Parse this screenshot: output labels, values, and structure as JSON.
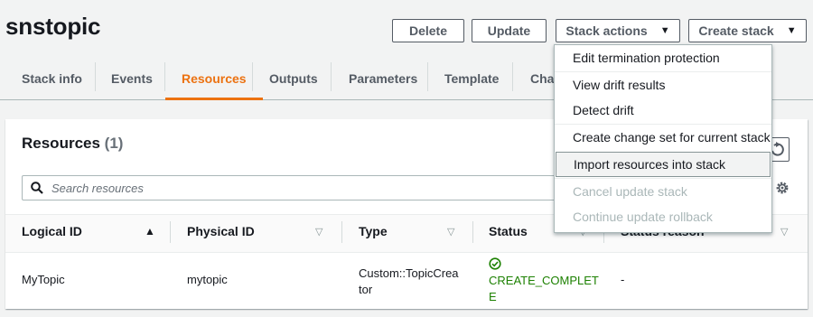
{
  "stack_name": "snstopic",
  "header_buttons": {
    "delete": "Delete",
    "update": "Update",
    "stack_actions": "Stack actions",
    "create_stack": "Create stack"
  },
  "tabs": [
    "Stack info",
    "Events",
    "Resources",
    "Outputs",
    "Parameters",
    "Template",
    "Char"
  ],
  "active_tab": "Resources",
  "resources": {
    "title": "Resources",
    "count": "(1)",
    "search_placeholder": "Search resources",
    "columns": [
      "Logical ID",
      "Physical ID",
      "Type",
      "Status",
      "Status reason"
    ],
    "rows": [
      {
        "logical_id": "MyTopic",
        "physical_id": "mytopic",
        "type_line1": "Custom::TopicCrea",
        "type_line2": "tor",
        "status_line1": "CREATE_COMPLET",
        "status_line2": "E",
        "status_reason": "-"
      }
    ]
  },
  "stack_actions_menu": [
    {
      "label": "Edit termination protection",
      "enabled": true
    },
    {
      "label": "View drift results",
      "enabled": true
    },
    {
      "label": "Detect drift",
      "enabled": true
    },
    {
      "label": "Create change set for current stack",
      "enabled": true
    },
    {
      "label": "Import resources into stack",
      "enabled": true,
      "highlighted": true
    },
    {
      "label": "Cancel update stack",
      "enabled": false
    },
    {
      "label": "Continue update rollback",
      "enabled": false
    }
  ],
  "colors": {
    "accent": "#ec7211",
    "success": "#1d8102",
    "disabled": "#aab7b8"
  }
}
